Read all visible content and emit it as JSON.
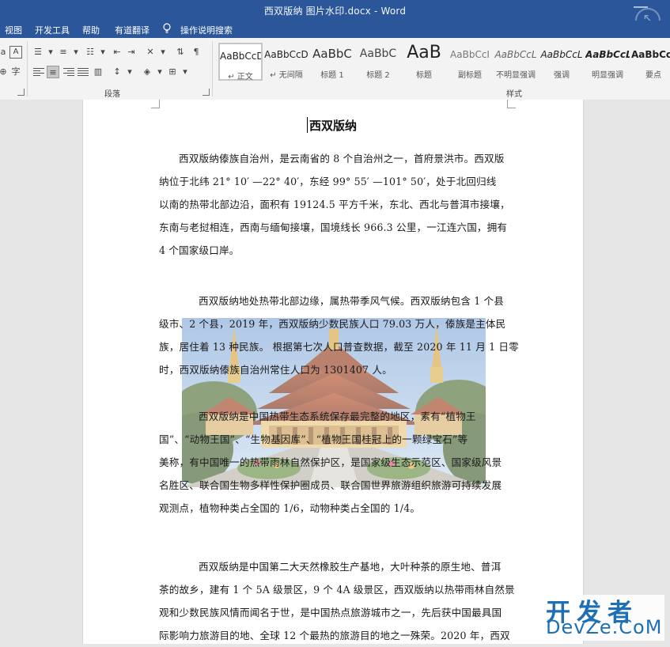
{
  "window": {
    "title": "西双版纳 图片水印.docx - Word"
  },
  "menu": {
    "items": [
      "视图",
      "开发工具",
      "帮助",
      "有道翻译"
    ],
    "tell_me": "操作说明搜索"
  },
  "ribbon": {
    "groups": {
      "paragraph": "段落",
      "styles": "样式"
    },
    "style_tiles": [
      {
        "sample": "AaBbCcD",
        "name": "↵ 正文"
      },
      {
        "sample": "AaBbCcD",
        "name": "↵ 无间隔"
      },
      {
        "sample": "AaBbC",
        "name": "标题 1"
      },
      {
        "sample": "AaBbC",
        "name": "标题 2"
      },
      {
        "sample": "AaB",
        "name": "标题"
      },
      {
        "sample": "AaBbCcI",
        "name": "副标题"
      },
      {
        "sample": "AaBbCcL",
        "name": "不明显强调"
      },
      {
        "sample": "AaBbCcL",
        "name": "强调"
      },
      {
        "sample": "AaBbCcL",
        "name": "明显强调"
      },
      {
        "sample": "AaBbCcD",
        "name": "要点"
      }
    ]
  },
  "document": {
    "title": "西双版纳",
    "paragraphs": [
      {
        "lines": [
          "西双版纳傣族自治州，是云南省的 8 个自治州之一，首府景洪市。西双版",
          "纳位于北纬 21° 10′ —22° 40′，东经 99° 55′ —101° 50′，处于北回归线",
          "以南的热带北部边沿，面积有 19124.5 平方千米，东北、西北与普洱市接壤，",
          "东南与老挝相连，西南与缅甸接壤，国境线长 966.3 公里，一江连六国，拥有",
          "4 个国家级口岸。"
        ]
      },
      {
        "lines": [
          "西双版纳地处热带北部边缘，属热带季风气候。西双版纳包含 1 个县",
          "级市、2 个县，2019 年，西双版纳少数民族人口 79.03 万人，傣族是主体民",
          "族，居住着 13 种民族。  根据第七次人口普查数据，截至 2020 年 11 月 1 日零",
          "时，西双版纳傣族自治州常住人口为 1301407 人。"
        ]
      },
      {
        "lines": [
          "西双版纳是中国热带生态系统保存最完整的地区，素有“植物王",
          "国”、“动物王国”、“生物基因库”、“植物王国桂冠上的一颗绿宝石”等",
          "美称，有中国唯一的热带雨林自然保护区，是国家级生态示范区、国家级风景",
          "名胜区、联合国生物多样性保护圈成员、联合国世界旅游组织旅游可持续发展",
          "观测点，植物种类占全国的 1/6，动物种类占全国的 1/4。"
        ]
      },
      {
        "lines": [
          "西双版纳是中国第二大天然橡胶生产基地，大叶种茶的原生地、普洱",
          "茶的故乡，建有 1 个 5A 级景区，9 个 4A 级景区，西双版纳以热带雨林自然景",
          "观和少数民族风情而闻名于世，是中国热点旅游城市之一，先后获中国最具国",
          "际影响力旅游目的地、全球 12 个最热的旅游目的地之一殊荣。2020 年，西双"
        ]
      }
    ]
  },
  "site_watermark": {
    "top": "开发者",
    "bottom": "DevZe.CoM"
  },
  "colors": {
    "title_bar": "#2b579a",
    "ribbon": "#f3f3f3",
    "page": "#ffffff",
    "site_mark": "#1f6fb4"
  }
}
